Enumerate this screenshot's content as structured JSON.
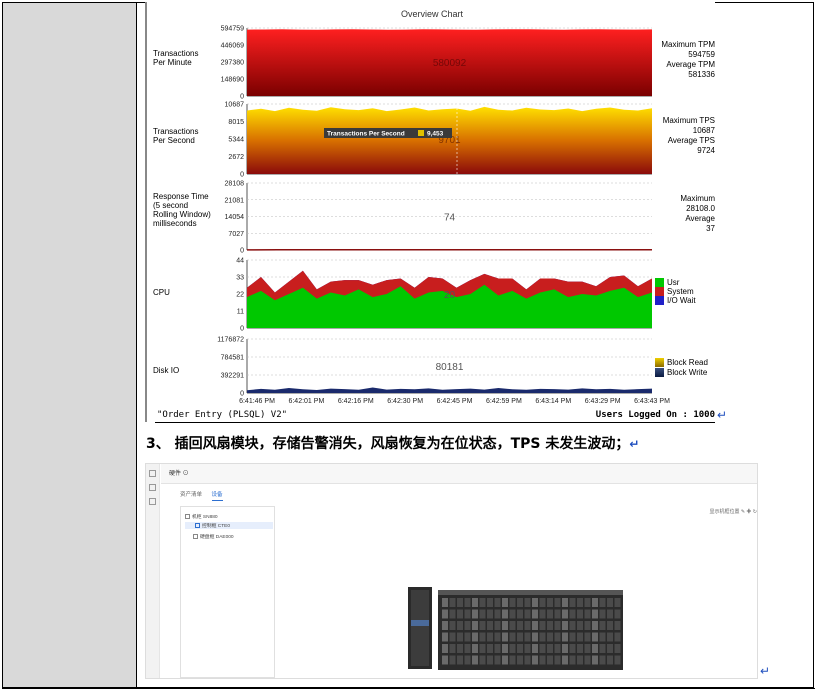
{
  "overview": {
    "title": "Overview Chart",
    "time_ticks": [
      "6:41:46 PM",
      "6:42:01 PM",
      "6:42:16 PM",
      "6:42:30 PM",
      "6:42:45 PM",
      "6:42:59 PM",
      "6:43:14 PM",
      "6:43:29 PM",
      "6:43:43 PM"
    ],
    "footer_left": "\"Order Entry (PLSQL) V2\"",
    "footer_right": "Users Logged On : 1000",
    "return_mark": "↵"
  },
  "chart_data": [
    {
      "type": "area",
      "label": "Transactions Per Minute",
      "yticks": [
        148690,
        297380,
        446069,
        594759
      ],
      "ylim": [
        0,
        594759
      ],
      "overlay_value": "580092",
      "info": [
        "Maximum TPM",
        "594759",
        "Average TPM",
        "581336"
      ],
      "colors": [
        "#ff1a1a",
        "#8b0000"
      ],
      "values": [
        581000,
        582000,
        583500,
        581200,
        580000,
        582800,
        584000,
        581700,
        579500,
        580600,
        583000,
        582300,
        581000,
        580200,
        582100,
        584200,
        583000,
        581500,
        580100,
        582400,
        583600,
        581800,
        580700,
        582600
      ]
    },
    {
      "type": "area",
      "label": "Transactions Per Second",
      "yticks": [
        2672,
        5344,
        8015,
        10687
      ],
      "ylim": [
        0,
        10687
      ],
      "overlay_value": "9701",
      "tooltip": {
        "label": "Transactions Per Second",
        "value": "9,453"
      },
      "info": [
        "Maximum TPS",
        "10687",
        "Average TPS",
        "9724"
      ],
      "colors": [
        "#ffd700",
        "#a01010"
      ],
      "values": [
        9700,
        9950,
        9600,
        10100,
        9800,
        9650,
        10200,
        9900,
        9750,
        10050,
        9600,
        9850,
        10150,
        9700,
        9900,
        10000,
        9650,
        10250,
        9800,
        9700,
        10100,
        9850,
        9750,
        10000,
        9600,
        9950,
        10150,
        9800,
        9700,
        10050
      ]
    },
    {
      "type": "line",
      "label": "Response Time (5 second Rolling Window) milliseconds",
      "yticks": [
        7027,
        14054,
        21081,
        28108
      ],
      "ylim": [
        0,
        28108
      ],
      "overlay_value": "74",
      "info": [
        "Maximum",
        "28108.0",
        "Average",
        "37"
      ],
      "values": [
        60,
        70,
        75,
        72,
        74,
        78,
        71,
        69,
        74,
        76,
        73,
        75,
        70,
        74
      ]
    },
    {
      "type": "area",
      "label": "CPU",
      "yticks": [
        11,
        22,
        33,
        44
      ],
      "ylim": [
        0,
        44
      ],
      "overlay_value": "20",
      "series": [
        {
          "name": "Usr",
          "color": "#00c800",
          "values": [
            20,
            24,
            18,
            22,
            26,
            19,
            23,
            21,
            25,
            20,
            22,
            27,
            19,
            23,
            24,
            20,
            22,
            28,
            21,
            24,
            19,
            23,
            25,
            20,
            22,
            21,
            24,
            26,
            20,
            23
          ]
        },
        {
          "name": "System",
          "color": "#c81e1e",
          "values": [
            6,
            9,
            5,
            8,
            11,
            6,
            7,
            10,
            6,
            8,
            9,
            5,
            7,
            10,
            8,
            6,
            9,
            7,
            11,
            8,
            6,
            9,
            7,
            10,
            8,
            6,
            9,
            8,
            7,
            9
          ]
        },
        {
          "name": "I/O Wait",
          "color": "#2020c8",
          "values": [
            0,
            0,
            0,
            0,
            0,
            0,
            0,
            0,
            0,
            0,
            0,
            0,
            0,
            0,
            0,
            0,
            0,
            0,
            0,
            0,
            0,
            0,
            0,
            0,
            0,
            0,
            0,
            0,
            0,
            0
          ]
        }
      ]
    },
    {
      "type": "area",
      "label": "Disk IO",
      "yticks": [
        392291,
        784581,
        1176872
      ],
      "ylim": [
        0,
        1176872
      ],
      "overlay_value": "80181",
      "series": [
        {
          "name": "Block Read",
          "color": "#d4b000",
          "values": [
            0,
            0,
            0,
            0,
            0,
            0,
            0,
            0,
            0,
            0,
            0,
            0,
            0,
            0,
            0,
            0,
            0,
            0,
            0,
            0,
            0,
            0,
            0,
            0,
            0,
            0,
            0,
            0,
            0,
            0
          ]
        },
        {
          "name": "Block Write",
          "color": "#1a2a6c",
          "values": [
            60000,
            90000,
            70000,
            110000,
            80000,
            65000,
            95000,
            85000,
            70000,
            120000,
            75000,
            90000,
            80000,
            100000,
            70000,
            85000,
            95000,
            75000,
            110000,
            80000,
            70000,
            90000,
            85000,
            75000,
            100000,
            80000,
            90000,
            70000,
            85000,
            95000
          ]
        }
      ]
    }
  ],
  "step": {
    "text": "3、 插回风扇模块，存储告警消失，风扇恢复为在位状态，TPS 未发生波动；",
    "return_mark": "↵"
  },
  "screenshot": {
    "header_title": "硬件 ⊙",
    "tabs": [
      "资产清单",
      "设备"
    ],
    "tree": [
      "机柜 SN880",
      "控制框 CTE0",
      "硬盘框 DAE000"
    ],
    "toolbar_text": "显示机框位置  ✎  ✚  ↻",
    "return_mark": "↵"
  }
}
